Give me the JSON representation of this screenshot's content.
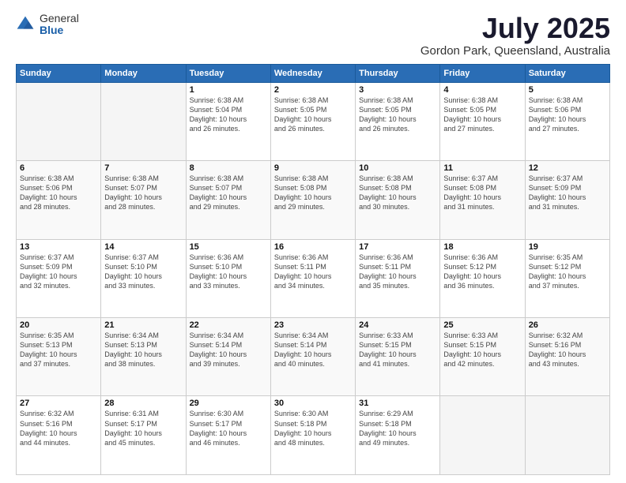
{
  "logo": {
    "general": "General",
    "blue": "Blue"
  },
  "title": {
    "month": "July 2025",
    "location": "Gordon Park, Queensland, Australia"
  },
  "headers": [
    "Sunday",
    "Monday",
    "Tuesday",
    "Wednesday",
    "Thursday",
    "Friday",
    "Saturday"
  ],
  "weeks": [
    [
      {
        "num": "",
        "detail": ""
      },
      {
        "num": "",
        "detail": ""
      },
      {
        "num": "1",
        "detail": "Sunrise: 6:38 AM\nSunset: 5:04 PM\nDaylight: 10 hours\nand 26 minutes."
      },
      {
        "num": "2",
        "detail": "Sunrise: 6:38 AM\nSunset: 5:05 PM\nDaylight: 10 hours\nand 26 minutes."
      },
      {
        "num": "3",
        "detail": "Sunrise: 6:38 AM\nSunset: 5:05 PM\nDaylight: 10 hours\nand 26 minutes."
      },
      {
        "num": "4",
        "detail": "Sunrise: 6:38 AM\nSunset: 5:05 PM\nDaylight: 10 hours\nand 27 minutes."
      },
      {
        "num": "5",
        "detail": "Sunrise: 6:38 AM\nSunset: 5:06 PM\nDaylight: 10 hours\nand 27 minutes."
      }
    ],
    [
      {
        "num": "6",
        "detail": "Sunrise: 6:38 AM\nSunset: 5:06 PM\nDaylight: 10 hours\nand 28 minutes."
      },
      {
        "num": "7",
        "detail": "Sunrise: 6:38 AM\nSunset: 5:07 PM\nDaylight: 10 hours\nand 28 minutes."
      },
      {
        "num": "8",
        "detail": "Sunrise: 6:38 AM\nSunset: 5:07 PM\nDaylight: 10 hours\nand 29 minutes."
      },
      {
        "num": "9",
        "detail": "Sunrise: 6:38 AM\nSunset: 5:08 PM\nDaylight: 10 hours\nand 29 minutes."
      },
      {
        "num": "10",
        "detail": "Sunrise: 6:38 AM\nSunset: 5:08 PM\nDaylight: 10 hours\nand 30 minutes."
      },
      {
        "num": "11",
        "detail": "Sunrise: 6:37 AM\nSunset: 5:08 PM\nDaylight: 10 hours\nand 31 minutes."
      },
      {
        "num": "12",
        "detail": "Sunrise: 6:37 AM\nSunset: 5:09 PM\nDaylight: 10 hours\nand 31 minutes."
      }
    ],
    [
      {
        "num": "13",
        "detail": "Sunrise: 6:37 AM\nSunset: 5:09 PM\nDaylight: 10 hours\nand 32 minutes."
      },
      {
        "num": "14",
        "detail": "Sunrise: 6:37 AM\nSunset: 5:10 PM\nDaylight: 10 hours\nand 33 minutes."
      },
      {
        "num": "15",
        "detail": "Sunrise: 6:36 AM\nSunset: 5:10 PM\nDaylight: 10 hours\nand 33 minutes."
      },
      {
        "num": "16",
        "detail": "Sunrise: 6:36 AM\nSunset: 5:11 PM\nDaylight: 10 hours\nand 34 minutes."
      },
      {
        "num": "17",
        "detail": "Sunrise: 6:36 AM\nSunset: 5:11 PM\nDaylight: 10 hours\nand 35 minutes."
      },
      {
        "num": "18",
        "detail": "Sunrise: 6:36 AM\nSunset: 5:12 PM\nDaylight: 10 hours\nand 36 minutes."
      },
      {
        "num": "19",
        "detail": "Sunrise: 6:35 AM\nSunset: 5:12 PM\nDaylight: 10 hours\nand 37 minutes."
      }
    ],
    [
      {
        "num": "20",
        "detail": "Sunrise: 6:35 AM\nSunset: 5:13 PM\nDaylight: 10 hours\nand 37 minutes."
      },
      {
        "num": "21",
        "detail": "Sunrise: 6:34 AM\nSunset: 5:13 PM\nDaylight: 10 hours\nand 38 minutes."
      },
      {
        "num": "22",
        "detail": "Sunrise: 6:34 AM\nSunset: 5:14 PM\nDaylight: 10 hours\nand 39 minutes."
      },
      {
        "num": "23",
        "detail": "Sunrise: 6:34 AM\nSunset: 5:14 PM\nDaylight: 10 hours\nand 40 minutes."
      },
      {
        "num": "24",
        "detail": "Sunrise: 6:33 AM\nSunset: 5:15 PM\nDaylight: 10 hours\nand 41 minutes."
      },
      {
        "num": "25",
        "detail": "Sunrise: 6:33 AM\nSunset: 5:15 PM\nDaylight: 10 hours\nand 42 minutes."
      },
      {
        "num": "26",
        "detail": "Sunrise: 6:32 AM\nSunset: 5:16 PM\nDaylight: 10 hours\nand 43 minutes."
      }
    ],
    [
      {
        "num": "27",
        "detail": "Sunrise: 6:32 AM\nSunset: 5:16 PM\nDaylight: 10 hours\nand 44 minutes."
      },
      {
        "num": "28",
        "detail": "Sunrise: 6:31 AM\nSunset: 5:17 PM\nDaylight: 10 hours\nand 45 minutes."
      },
      {
        "num": "29",
        "detail": "Sunrise: 6:30 AM\nSunset: 5:17 PM\nDaylight: 10 hours\nand 46 minutes."
      },
      {
        "num": "30",
        "detail": "Sunrise: 6:30 AM\nSunset: 5:18 PM\nDaylight: 10 hours\nand 48 minutes."
      },
      {
        "num": "31",
        "detail": "Sunrise: 6:29 AM\nSunset: 5:18 PM\nDaylight: 10 hours\nand 49 minutes."
      },
      {
        "num": "",
        "detail": ""
      },
      {
        "num": "",
        "detail": ""
      }
    ]
  ]
}
